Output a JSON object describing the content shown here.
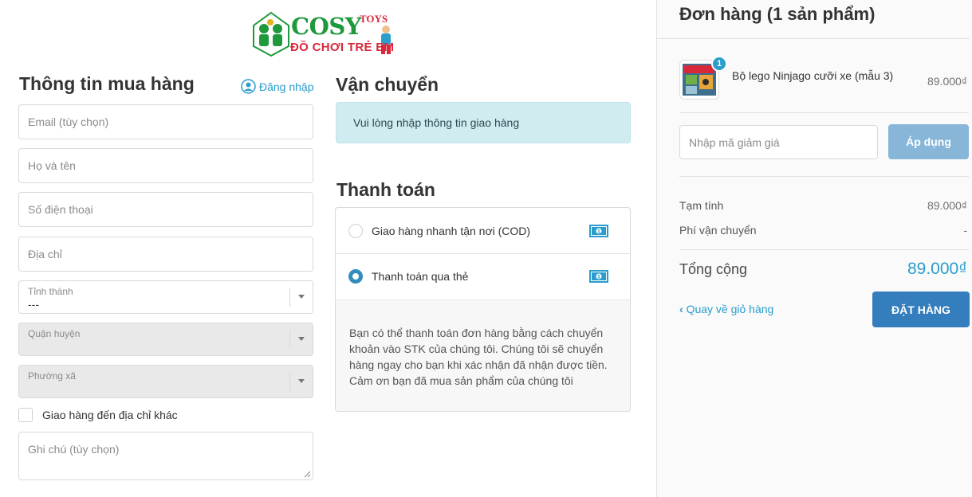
{
  "logo": {
    "brand": "COSY",
    "toys": "TOYS",
    "subtitle": "ĐỒ CHƠI TRẺ EM"
  },
  "buyer": {
    "title": "Thông tin mua hàng",
    "login_label": "Đăng nhập",
    "email_placeholder": "Email (tùy chọn)",
    "name_placeholder": "Họ và tên",
    "phone_placeholder": "Số điện thoại",
    "address_placeholder": "Địa chỉ",
    "province_label": "Tỉnh thành",
    "province_value": "---",
    "district_label": "Quận huyện",
    "ward_label": "Phường xã",
    "alt_address_label": "Giao hàng đến địa chỉ khác",
    "note_placeholder": "Ghi chú (tùy chọn)"
  },
  "shipping": {
    "title": "Vận chuyển",
    "notice": "Vui lòng nhập thông tin giao hàng"
  },
  "payment": {
    "title": "Thanh toán",
    "options": [
      {
        "label": "Giao hàng nhanh tận nơi (COD)",
        "selected": false,
        "icon": "cash-icon"
      },
      {
        "label": "Thanh toán qua thẻ",
        "selected": true,
        "icon": "cash-icon"
      }
    ],
    "description": "Bạn có thể thanh toán đơn hàng bằng cách chuyển khoản vào STK của chúng tôi. Chúng tôi sẽ chuyển hàng ngay cho bạn khi xác nhận đã nhận được tiền. Cảm ơn bạn đã mua sản phẩm của chúng tôi"
  },
  "order": {
    "title": "Đơn hàng (1 sản phẩm)",
    "product": {
      "name": "Bộ lego Ninjago cưỡi xe (mẫu 3)",
      "price": "89.000₫",
      "quantity": "1"
    },
    "coupon_placeholder": "Nhập mã giảm giá",
    "apply_label": "Áp dụng",
    "subtotal_label": "Tạm tính",
    "subtotal_value": "89.000₫",
    "shipping_fee_label": "Phí vận chuyển",
    "shipping_fee_value": "-",
    "total_label": "Tổng cộng",
    "total_value": "89.000₫",
    "back_label": "Quay về giỏ hàng",
    "place_order_label": "ĐẶT HÀNG"
  },
  "colors": {
    "accent": "#2a9dcc",
    "primary_button": "#357ebd",
    "apply_button": "#87b6d8",
    "info_bg": "#d1ecf1"
  }
}
